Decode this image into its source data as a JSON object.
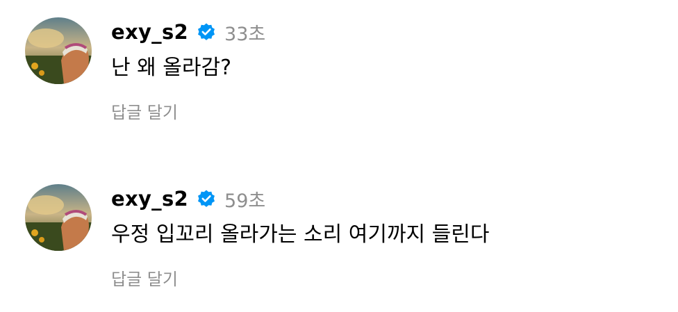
{
  "comments": [
    {
      "username": "exy_s2",
      "verified_icon": "verified-badge-icon",
      "timestamp": "33초",
      "text": "난 왜 올라감?",
      "reply_label": "답글 달기"
    },
    {
      "username": "exy_s2",
      "verified_icon": "verified-badge-icon",
      "timestamp": "59초",
      "text": "우정 입꼬리 올라가는 소리 여기까지 들린다",
      "reply_label": "답글 달기"
    }
  ],
  "colors": {
    "text": "#000000",
    "muted": "#8e8e8e",
    "verified": "#0095f6",
    "background": "#ffffff"
  }
}
